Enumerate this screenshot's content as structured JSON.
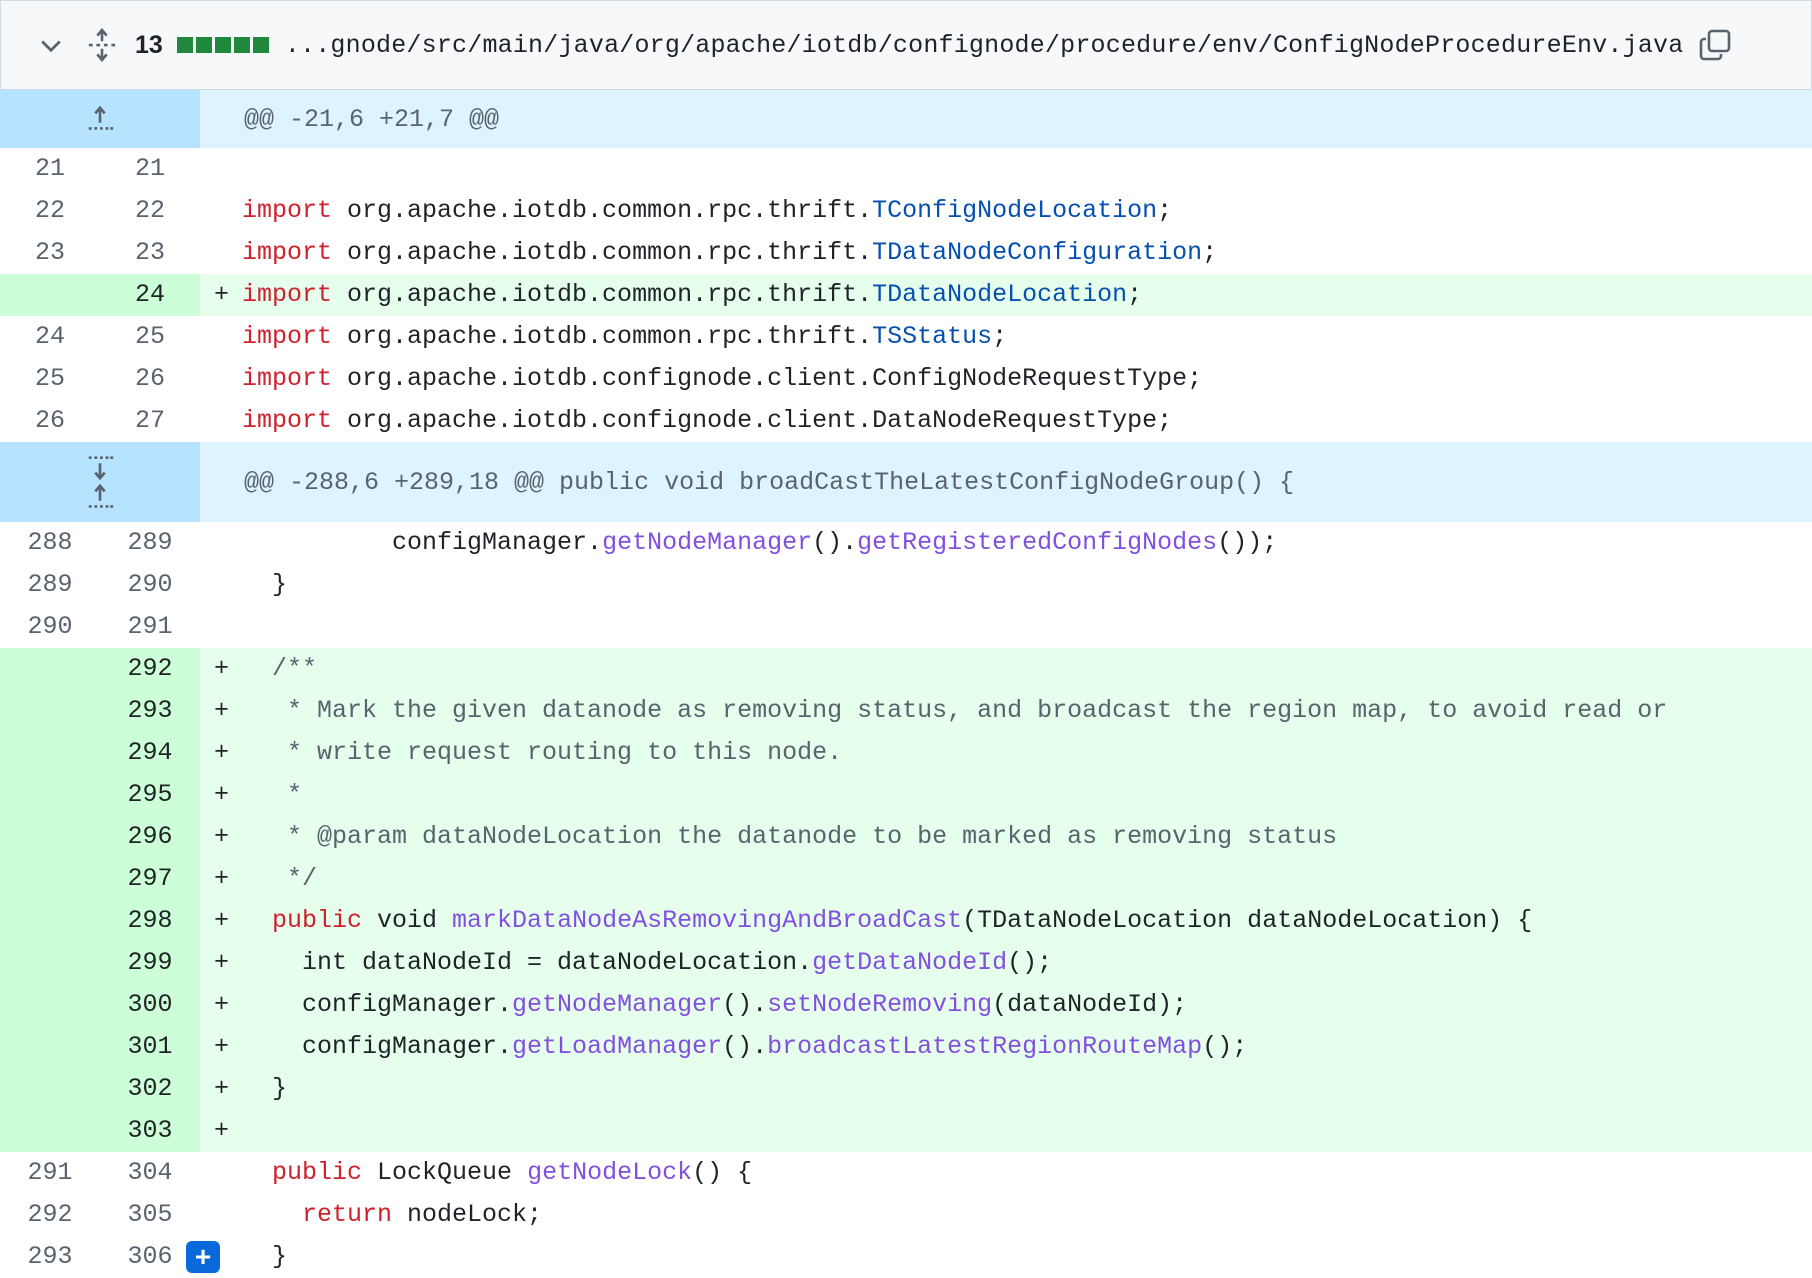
{
  "file": {
    "changes_count": "13",
    "path": "...gnode/src/main/java/org/apache/iotdb/confignode/procedure/env/ConfigNodeProcedureEnv.java"
  },
  "hunks": [
    {
      "header": "@@ -21,6 +21,7 @@"
    },
    {
      "header": "@@ -288,6 +289,18 @@ public void broadCastTheLatestConfigNodeGroup() {"
    }
  ],
  "lines": {
    "l1": {
      "old": "21",
      "new": "21"
    },
    "l2": {
      "old": "22",
      "new": "22"
    },
    "l3": {
      "old": "23",
      "new": "23"
    },
    "l4": {
      "old": "",
      "new": "24"
    },
    "l5": {
      "old": "24",
      "new": "25"
    },
    "l6": {
      "old": "25",
      "new": "26"
    },
    "l7": {
      "old": "26",
      "new": "27"
    },
    "m1": {
      "old": "288",
      "new": "289"
    },
    "m2": {
      "old": "289",
      "new": "290"
    },
    "m3": {
      "old": "290",
      "new": "291"
    },
    "a1": {
      "new": "292"
    },
    "a2": {
      "new": "293"
    },
    "a3": {
      "new": "294"
    },
    "a4": {
      "new": "295"
    },
    "a5": {
      "new": "296"
    },
    "a6": {
      "new": "297"
    },
    "a7": {
      "new": "298"
    },
    "a8": {
      "new": "299"
    },
    "a9": {
      "new": "300"
    },
    "a10": {
      "new": "301"
    },
    "a11": {
      "new": "302"
    },
    "a12": {
      "new": "303"
    },
    "e1": {
      "old": "291",
      "new": "304"
    },
    "e2": {
      "old": "292",
      "new": "305"
    },
    "e3": {
      "old": "293",
      "new": "306"
    }
  },
  "code": {
    "import": "import",
    "pkg_thrift": " org.apache.iotdb.common.rpc.thrift.",
    "t_cfgloc": "TConfigNodeLocation",
    "t_dnconf": "TDataNodeConfiguration",
    "t_dnloc": "TDataNodeLocation",
    "t_status": "TSStatus",
    "semi": ";",
    "cfg_req": " org.apache.iotdb.confignode.client.ConfigNodeRequestType;",
    "dn_req": " org.apache.iotdb.confignode.client.DataNodeRequestType;",
    "m1_a": "          configManager.",
    "m1_b": "getNodeManager",
    "m1_c": "().",
    "m1_d": "getRegisteredConfigNodes",
    "m1_e": "());",
    "m2": "  }",
    "a1": "  /**",
    "a2": "   * Mark the given datanode as removing status, and broadcast the region map, to avoid read or",
    "a3": "   * write request routing to this node.",
    "a4": "   *",
    "a5": "   * @param dataNodeLocation the datanode to be marked as removing status",
    "a6": "   */",
    "a7_pub": "  public",
    "a7_void": " void ",
    "a7_fn": "markDataNodeAsRemovingAndBroadCast",
    "a7_rest": "(TDataNodeLocation dataNodeLocation) {",
    "a8_a": "    int dataNodeId = dataNodeLocation.",
    "a8_fn": "getDataNodeId",
    "a8_b": "();",
    "a9_a": "    configManager.",
    "a9_fn1": "getNodeManager",
    "a9_b": "().",
    "a9_fn2": "setNodeRemoving",
    "a9_c": "(dataNodeId);",
    "a10_a": "    configManager.",
    "a10_fn1": "getLoadManager",
    "a10_b": "().",
    "a10_fn2": "broadcastLatestRegionRouteMap",
    "a10_c": "();",
    "a11": "  }",
    "e1_pub": "  public",
    "e1_type": " LockQueue ",
    "e1_fn": "getNodeLock",
    "e1_rest": "() {",
    "e2_ret": "    return",
    "e2_rest": " nodeLock;",
    "e3": "  }"
  },
  "add_marker": "+",
  "add_comment_button": "+"
}
